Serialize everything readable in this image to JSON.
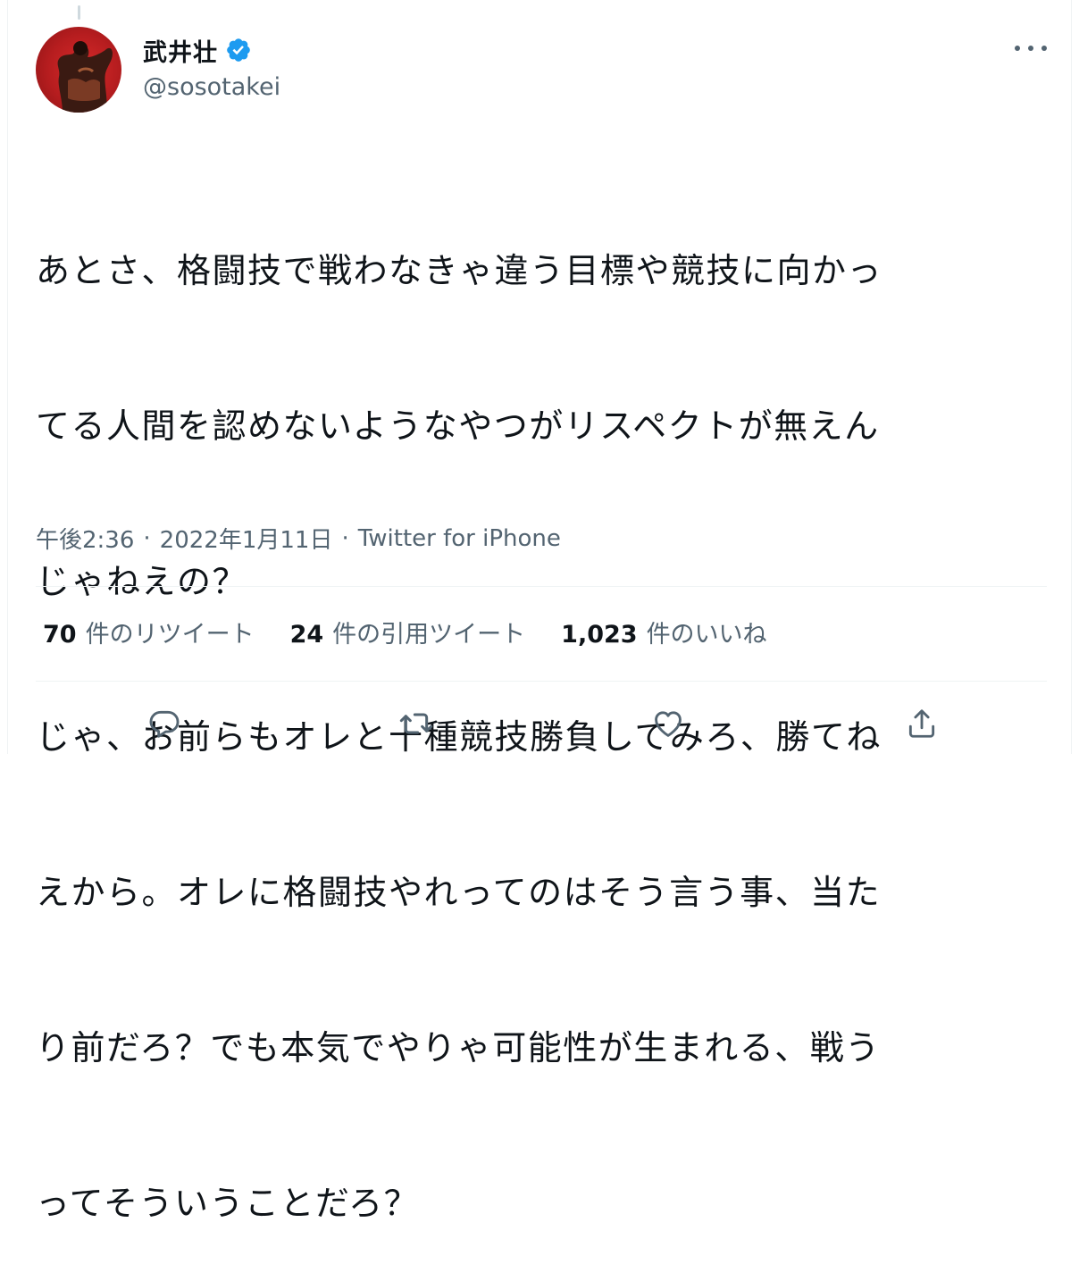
{
  "author": {
    "display_name": "武井壮",
    "handle": "@sosotakei",
    "verified": true
  },
  "tweet": {
    "lines": [
      "あとさ、格闘技で戦わなきゃ違う目標や競技に向かっ",
      "てる人間を認めないようなやつがリスペクトが無えん",
      "じゃねえの？",
      "じゃ、お前らもオレと十種競技勝負してみろ、勝てね",
      "えから。オレに格闘技やれってのはそう言う事、当た",
      "り前だろ？でも本気でやりゃ可能性が生まれる、戦う",
      "ってそういうことだろ？"
    ]
  },
  "meta": {
    "time": "午後2:36",
    "separator": "·",
    "date": "2022年1月11日",
    "source": "Twitter for iPhone"
  },
  "stats": {
    "retweets": {
      "count": "70",
      "label": "件のリツイート"
    },
    "quotes": {
      "count": "24",
      "label": "件の引用ツイート"
    },
    "likes": {
      "count": "1,023",
      "label": "件のいいね"
    }
  },
  "actions": [
    "reply-icon",
    "retweet-icon",
    "like-icon",
    "share-icon"
  ],
  "colors": {
    "text": "#0f1419",
    "secondary": "#536471",
    "verified": "#1d9bf0",
    "divider": "#eff3f4"
  }
}
